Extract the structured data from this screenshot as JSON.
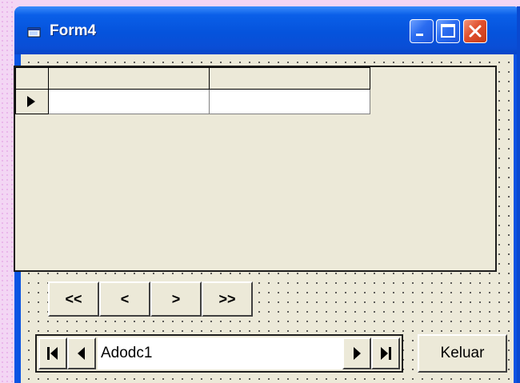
{
  "window": {
    "title": "Form4",
    "controls": [
      "minimize-icon",
      "maximize-icon",
      "close-icon"
    ]
  },
  "grid": {
    "columns": [
      "",
      ""
    ],
    "rows": [
      [
        "",
        ""
      ]
    ]
  },
  "nav_buttons": {
    "first": "<<",
    "prev": "<",
    "next": ">",
    "last": ">>"
  },
  "adodc": {
    "caption": "Adodc1",
    "icons": [
      "move-first-icon",
      "move-previous-icon",
      "move-next-icon",
      "move-last-icon"
    ]
  },
  "keluar_button": "Keluar",
  "colors": {
    "titlebar": "#0553dc",
    "face": "#ece9d8",
    "close": "#e0502e"
  }
}
